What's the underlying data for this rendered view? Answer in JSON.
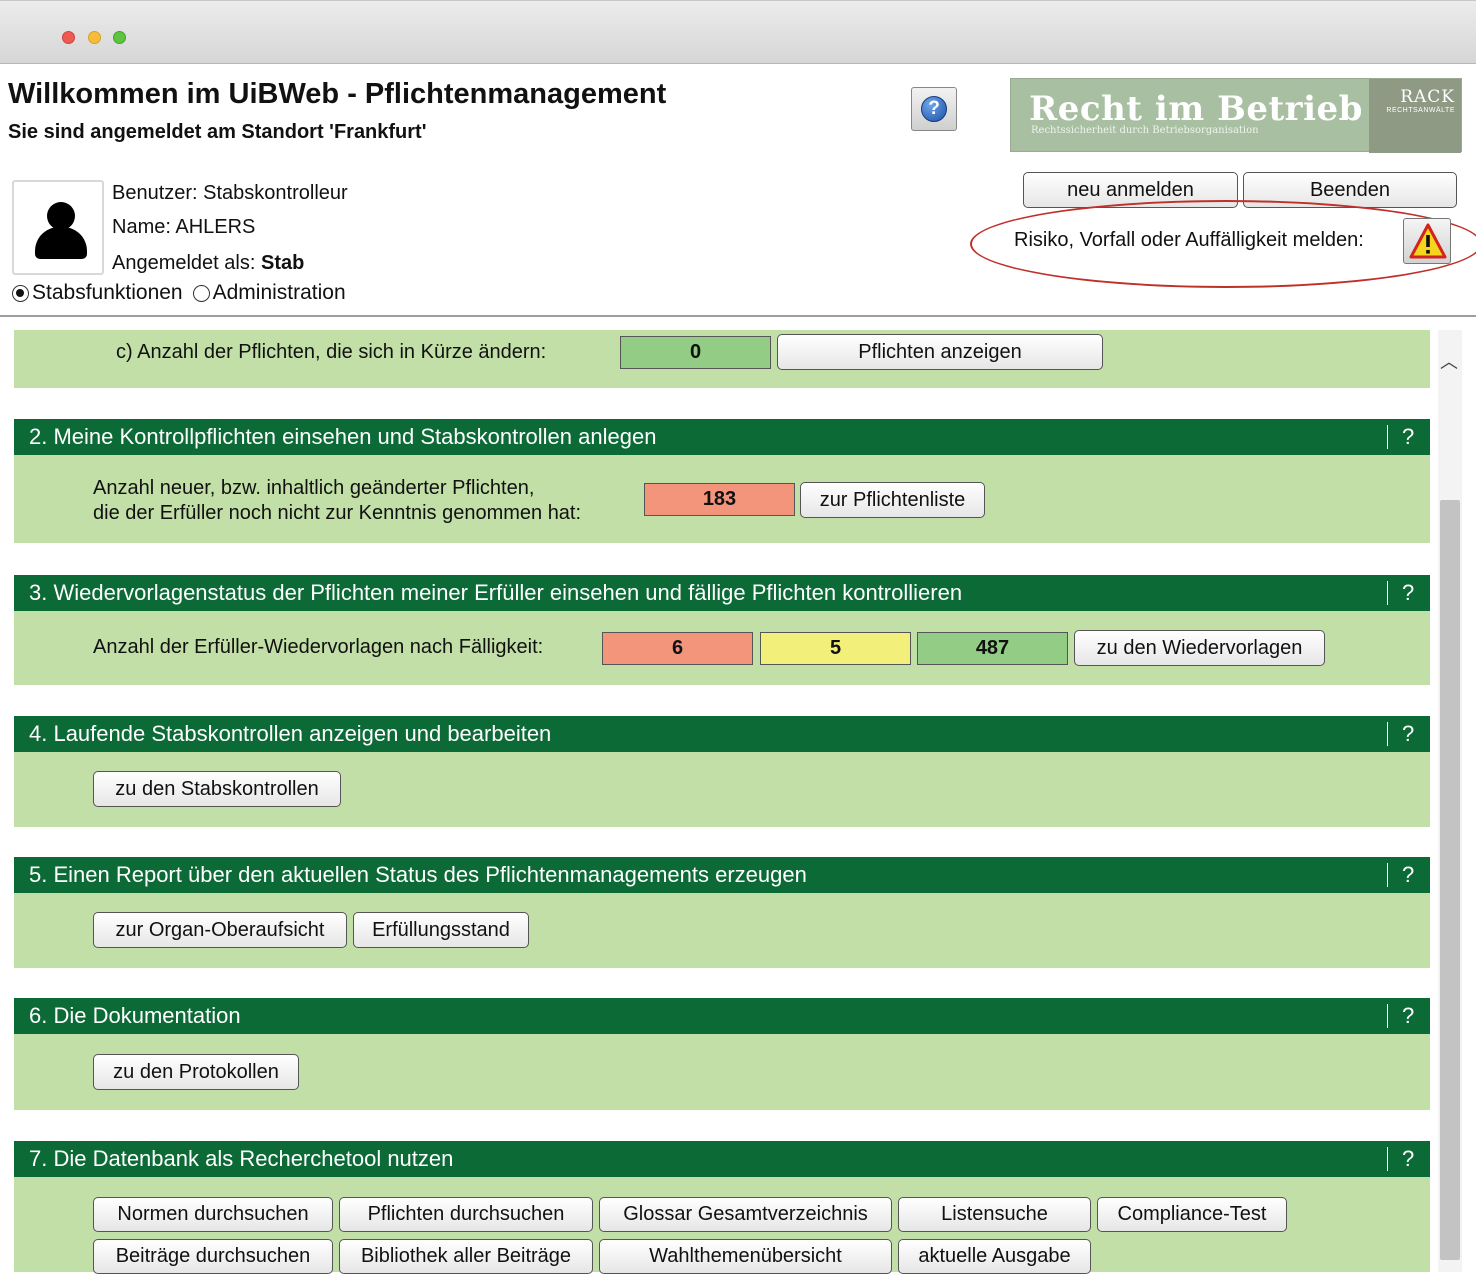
{
  "header": {
    "title": "Willkommen im UiBWeb - Pflichtenmanagement",
    "subtitle": "Sie sind angemeldet am Standort 'Frankfurt'",
    "help_glyph": "?",
    "logo_main": "Recht im Betrieb",
    "logo_tagline": "Rechtssicherheit durch Betriebsorganisation",
    "logo_brand": "RACK",
    "logo_brand_sub": "RECHTSANWÄLTE"
  },
  "user": {
    "benutzer": "Benutzer: Stabskontrolleur",
    "name": "Name: AHLERS",
    "angemeldet_label": "Angemeldet als: ",
    "angemeldet_value": "Stab",
    "radio_1": "Stabsfunktionen",
    "radio_2": "Administration"
  },
  "actions": {
    "neu_anmelden": "neu anmelden",
    "beenden": "Beenden",
    "risk_label": "Risiko, Vorfall oder Auffälligkeit melden:"
  },
  "section_c": {
    "label": "c) Anzahl der Pflichten, die sich in Kürze ändern:",
    "value": "0",
    "button": "Pflichten anzeigen"
  },
  "sections": [
    {
      "title": "2. Meine Kontrollpflichten einsehen und Stabskontrollen anlegen",
      "help": "?"
    },
    {
      "title": "3. Wiedervorlagenstatus der Pflichten meiner Erfüller einsehen und fällige Pflichten kontrollieren",
      "help": "?"
    },
    {
      "title": "4. Laufende Stabskontrollen anzeigen und bearbeiten",
      "help": "?"
    },
    {
      "title": "5. Einen Report über den aktuellen Status des Pflichtenmanagements erzeugen",
      "help": "?"
    },
    {
      "title": "6. Die Dokumentation",
      "help": "?"
    },
    {
      "title": "7. Die Datenbank als Recherchetool nutzen",
      "help": "?"
    }
  ],
  "sec2": {
    "label_line1": "Anzahl neuer, bzw. inhaltlich geänderter Pflichten,",
    "label_line2": "die der Erfüller noch nicht zur Kenntnis genommen hat:",
    "value": "183",
    "button": "zur Pflichtenliste"
  },
  "sec3": {
    "label": "Anzahl der Erfüller-Wiedervorlagen nach Fälligkeit:",
    "red": "6",
    "yellow": "5",
    "green": "487",
    "button": "zu den Wiedervorlagen"
  },
  "sec4": {
    "button": "zu den Stabskontrollen"
  },
  "sec5": {
    "button_1": "zur Organ-Oberaufsicht",
    "button_2": "Erfüllungsstand"
  },
  "sec6": {
    "button": "zu den Protokollen"
  },
  "sec7": {
    "row1": [
      "Normen durchsuchen",
      "Pflichten durchsuchen",
      "Glossar Gesamtverzeichnis",
      "Listensuche",
      "Compliance-Test"
    ],
    "row2": [
      "Beiträge durchsuchen",
      "Bibliothek aller Beiträge",
      "Wahlthemenübersicht",
      "aktuelle Ausgabe"
    ]
  },
  "colors": {
    "section_header": "#0c6a37",
    "panel": "#c1dfa6",
    "value_green": "#93cc85",
    "value_red": "#f2957a",
    "value_yellow": "#f3ef7b"
  },
  "icons": {
    "avatar": "user-silhouette-icon",
    "help": "question-circle-icon",
    "warning": "warning-triangle-icon",
    "scroll_up": "chevron-up-icon"
  }
}
